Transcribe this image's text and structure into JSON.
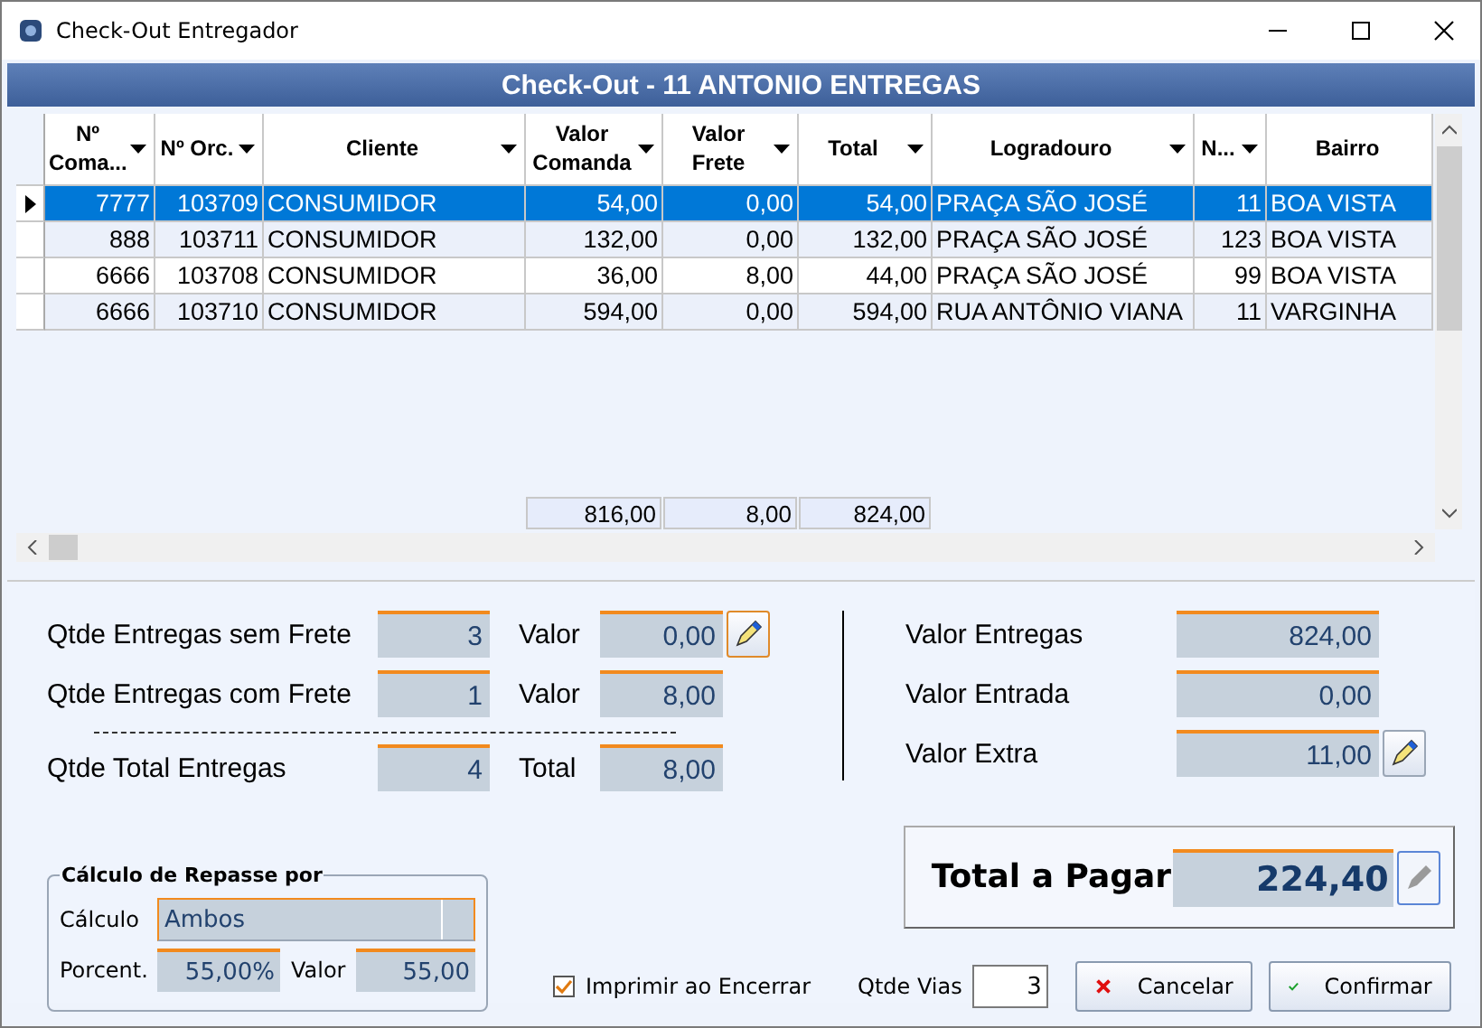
{
  "window": {
    "title": "Check-Out Entregador"
  },
  "header": {
    "title": "Check-Out - 11 ANTONIO ENTREGAS"
  },
  "table": {
    "columns": [
      {
        "label": "Nº Coma...",
        "dropdown": true
      },
      {
        "label": "Nº Orc.",
        "dropdown": true
      },
      {
        "label": "Cliente",
        "dropdown": true
      },
      {
        "label": "Valor Comanda",
        "dropdown": true
      },
      {
        "label": "Valor Frete",
        "dropdown": true
      },
      {
        "label": "Total",
        "dropdown": true
      },
      {
        "label": "Logradouro",
        "dropdown": true
      },
      {
        "label": "N...",
        "dropdown": true
      },
      {
        "label": "Bairro",
        "dropdown": false
      }
    ],
    "rows": [
      {
        "selected": true,
        "cells": [
          "7777",
          "103709",
          "CONSUMIDOR",
          "54,00",
          "0,00",
          "54,00",
          "PRAÇA SÃO JOSÉ",
          "11",
          "BOA VISTA"
        ]
      },
      {
        "selected": false,
        "cells": [
          "888",
          "103711",
          "CONSUMIDOR",
          "132,00",
          "0,00",
          "132,00",
          "PRAÇA SÃO JOSÉ",
          "123",
          "BOA VISTA"
        ]
      },
      {
        "selected": false,
        "cells": [
          "6666",
          "103708",
          "CONSUMIDOR",
          "36,00",
          "8,00",
          "44,00",
          "PRAÇA SÃO JOSÉ",
          "99",
          "BOA VISTA"
        ]
      },
      {
        "selected": false,
        "cells": [
          "6666",
          "103710",
          "CONSUMIDOR",
          "594,00",
          "0,00",
          "594,00",
          "RUA ANTÔNIO VIANA",
          "11",
          "VARGINHA"
        ]
      }
    ],
    "totals": [
      "816,00",
      "8,00",
      "824,00"
    ]
  },
  "deliveries": [
    {
      "label": "Qtde Entregas sem Frete",
      "count": "3",
      "value_label": "Valor",
      "value": "0,00",
      "editable": true
    },
    {
      "label": "Qtde Entregas com Frete",
      "count": "1",
      "value_label": "Valor",
      "value": "8,00",
      "editable": false
    },
    {
      "label": "Qtde Total Entregas",
      "count": "4",
      "value_label": "Total",
      "value": "8,00",
      "editable": false
    }
  ],
  "values": [
    {
      "label": "Valor Entregas",
      "value": "824,00",
      "editable": false
    },
    {
      "label": "Valor Entrada",
      "value": "0,00",
      "editable": false
    },
    {
      "label": "Valor Extra",
      "value": "11,00",
      "editable": true
    }
  ],
  "total": {
    "label": "Total a Pagar",
    "value": "224,40"
  },
  "repasse": {
    "title": "Cálculo de Repasse por",
    "calculo_label": "Cálculo",
    "calculo": "Ambos",
    "porcent_label": "Porcent.",
    "porcent": "55,00%",
    "valor_label": "Valor",
    "valor": "55,00"
  },
  "print_on_close": {
    "label": "Imprimir ao Encerrar",
    "checked": true
  },
  "copies": {
    "label": "Qtde Vias",
    "value": "3"
  },
  "buttons": [
    {
      "label": "Cancelar",
      "kind": "cancel"
    },
    {
      "label": "Confirmar",
      "kind": "confirm"
    }
  ]
}
